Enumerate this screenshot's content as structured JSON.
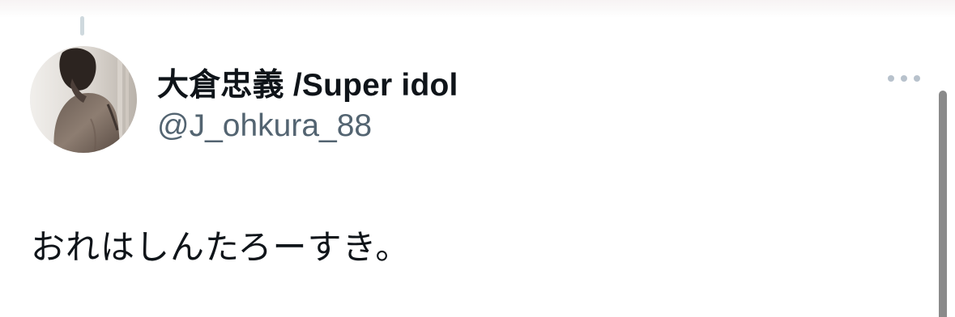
{
  "tweet": {
    "display_name": "大倉忠義 /Super idol",
    "handle": "@J_ohkura_88",
    "text": "おれはしんたろーすき。"
  },
  "icons": {
    "more": "more-horizontal-icon",
    "avatar": "profile-photo"
  },
  "colors": {
    "name": "#0f1419",
    "handle": "#536471",
    "text": "#0f1419",
    "thread_line": "#cfd9de",
    "more_dots": "#b8c2cc",
    "scrollbar": "#8a8a8a"
  }
}
